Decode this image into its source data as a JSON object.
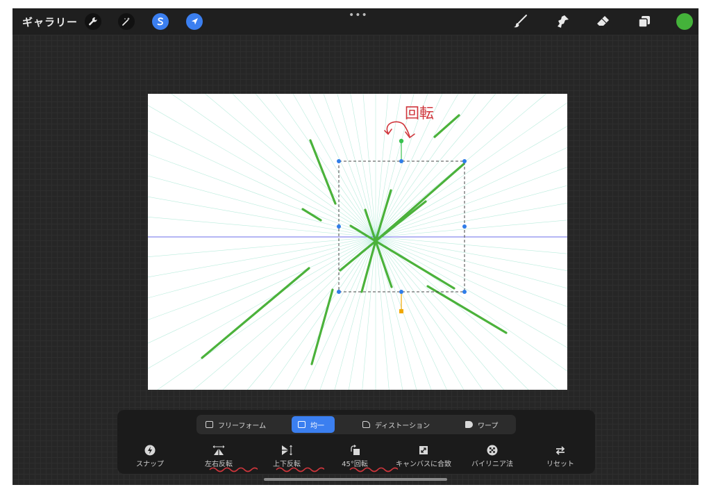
{
  "topbar": {
    "gallery_label": "ギャラリー",
    "left_tools": [
      "wrench-icon",
      "magic-wand-icon",
      "selection-icon",
      "transform-arrow-icon"
    ],
    "more_label": "•••",
    "right_tools": [
      "brush-icon",
      "smudge-icon",
      "eraser-icon",
      "layers-icon"
    ],
    "current_color": "#44b23a"
  },
  "canvas": {
    "annotation_text": "回転",
    "annotation_color": "#d0363c",
    "stroke_color": "#4bb23b",
    "guide_color": "#7fdcc0",
    "horizon_color": "#6a6ee8"
  },
  "transform": {
    "modes": [
      {
        "label": "フリーフォーム",
        "active": false
      },
      {
        "label": "均一",
        "active": true
      },
      {
        "label": "ディストーション",
        "active": false
      },
      {
        "label": "ワープ",
        "active": false
      }
    ],
    "actions": [
      {
        "label": "スナップ",
        "icon": "snap-icon"
      },
      {
        "label": "左右反転",
        "icon": "flip-horizontal-icon"
      },
      {
        "label": "上下反転",
        "icon": "flip-vertical-icon"
      },
      {
        "label": "45°回転",
        "icon": "rotate-45-icon"
      },
      {
        "label": "キャンバスに合致",
        "icon": "fit-to-canvas-icon"
      },
      {
        "label": "バイリニア法",
        "icon": "interpolation-icon"
      },
      {
        "label": "リセット",
        "icon": "reset-icon"
      }
    ]
  },
  "accent": "#3b7ff0"
}
